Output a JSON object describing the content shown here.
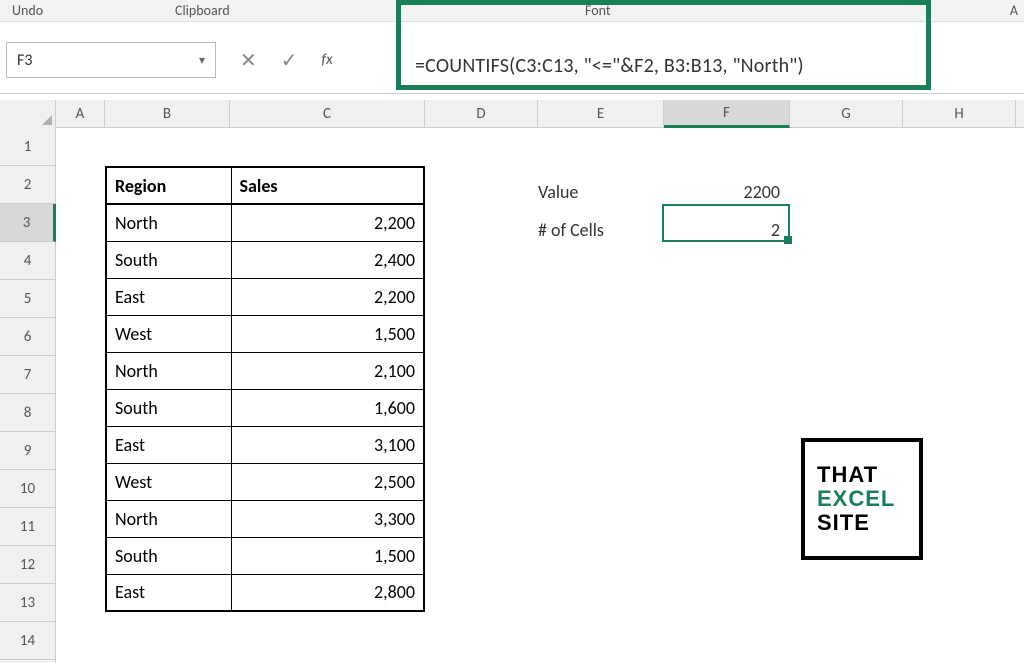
{
  "ribbon": {
    "undo": "Undo",
    "clipboard": "Clipboard",
    "font": "Font",
    "a": "A"
  },
  "nameBox": "F3",
  "formula": "=COUNTIFS(C3:C13, \"<=\"&F2, B3:B13, \"North\")",
  "columns": [
    "A",
    "B",
    "C",
    "D",
    "E",
    "F",
    "G",
    "H"
  ],
  "rows": [
    "1",
    "2",
    "3",
    "4",
    "5",
    "6",
    "7",
    "8",
    "9",
    "10",
    "11",
    "12",
    "13",
    "14"
  ],
  "table": {
    "headers": [
      "Region",
      "Sales"
    ],
    "rows": [
      [
        "North",
        "2,200"
      ],
      [
        "South",
        "2,400"
      ],
      [
        "East",
        "2,200"
      ],
      [
        "West",
        "1,500"
      ],
      [
        "North",
        "2,100"
      ],
      [
        "South",
        "1,600"
      ],
      [
        "East",
        "3,100"
      ],
      [
        "West",
        "2,500"
      ],
      [
        "North",
        "3,300"
      ],
      [
        "South",
        "1,500"
      ],
      [
        "East",
        "2,800"
      ]
    ]
  },
  "side": {
    "valueLabel": "Value",
    "valueVal": "2200",
    "cellsLabel": "# of Cells",
    "cellsVal": "2"
  },
  "logo": {
    "l1": "THAT",
    "l2": "EXCEL",
    "l3": "SITE"
  }
}
